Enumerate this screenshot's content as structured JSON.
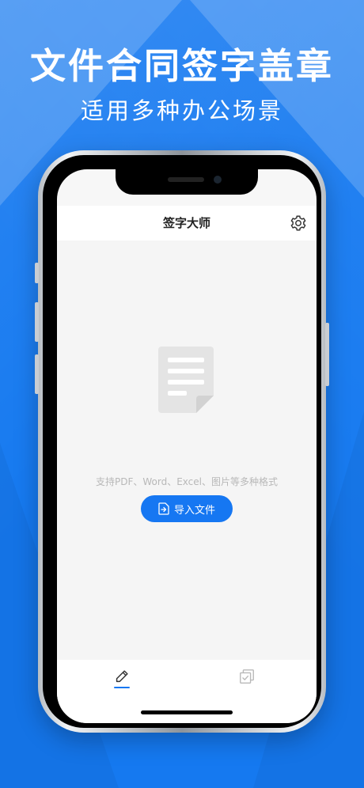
{
  "promo": {
    "title": "文件合同签字盖章",
    "subtitle": "适用多种办公场景"
  },
  "app": {
    "title": "签字大师"
  },
  "empty_state": {
    "support_text": "支持PDF、Word、Excel、图片等多种格式",
    "import_label": "导入文件"
  },
  "tabs": [
    {
      "icon": "pen-icon",
      "active": true
    },
    {
      "icon": "document-check-icon",
      "active": false
    }
  ],
  "colors": {
    "background": "#1579f0",
    "accent": "#1677f2",
    "muted_text": "#b8b8b8",
    "screen_bg": "#f5f5f5"
  },
  "icons": {
    "settings": "gear-icon",
    "empty_doc": "document-icon",
    "import": "file-import-icon"
  }
}
